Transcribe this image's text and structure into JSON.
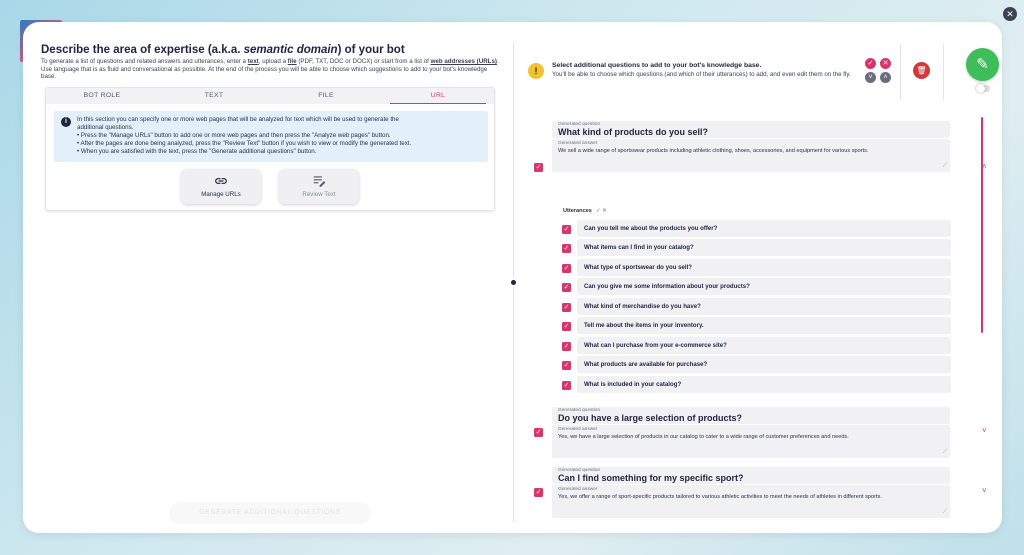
{
  "dialog": {
    "close_label": "✕"
  },
  "left": {
    "title_prefix": "Describe the area of expertise (a.k.a. ",
    "title_em": "semantic domain",
    "title_suffix": ") of your bot",
    "desc_1": "To generate a list of questions and related answers and utterances, enter a ",
    "desc_text": "text",
    "desc_2": ", upload a ",
    "desc_file": "file",
    "desc_3": " (PDF, TXT, DOC or DOCX) or start from a list of ",
    "desc_urls": "web addresses (URLs)",
    "desc_4": ". Use language that is as fluid and conversational as possible. At the end of the process you will be able to choose which suggestions to add to your bot's knowledge base.",
    "tabs": [
      "BOT ROLE",
      "TEXT",
      "FILE",
      "URL"
    ],
    "info_lines": [
      "In this section you can specify one or more web pages that will be analyzed for text which will be used to generate the",
      "additional questions.",
      "• Press the \"Manage URLs\" button to add one or more web pages and then press the \"Analyze web pages\" button.",
      "• After the pages are done being analyzed, press the \"Review Text\" button if you wish to view or modify the generated text.",
      "• When you are satisfied with the text, press the \"Generate additional questions\" button."
    ],
    "manage_urls_label": "Manage URLs",
    "review_text_label": "Review Text",
    "generate_label": "GENERATE ADDITIONAL QUESTIONS"
  },
  "right": {
    "title": "Select additional questions to add to your bot's knowledge base.",
    "subtitle": "You'll be able to choose which questions (and which of their utterances) to add, and even edit them on the fly.",
    "toggle_label": "",
    "question_label": "Generated question",
    "answer_label": "Generated answer",
    "utterances_label": "Utterances",
    "items": [
      {
        "question": "What kind of products do you sell?",
        "answer": "We sell a wide range of sportswear products including athletic clothing, shoes, accessories, and equipment for various sports.",
        "utterances": [
          "Can you tell me about the products you offer?",
          "What items can I find in your catalog?",
          "What type of sportswear do you sell?",
          "Can you give me some information about your products?",
          "What kind of merchandise do you have?",
          "Tell me about the items in your inventory.",
          "What can I purchase from your e-commerce site?",
          "What products are available for purchase?",
          "What is included in your catalog?"
        ]
      },
      {
        "question": "Do you have a large selection of products?",
        "answer": "Yes, we have a large selection of products in our catalog to cater to a wide range of customer preferences and needs."
      },
      {
        "question": "Can I find something for my specific sport?",
        "answer": "Yes, we offer a range of sport-specific products tailored to various athletic activities to meet the needs of athletes in different sports."
      }
    ]
  },
  "colors": {
    "accent": "#d6366a",
    "info_bg": "#e3f0fa",
    "save": "#3fbd5a",
    "delete": "#d23a3a",
    "warning": "#f2c230"
  }
}
